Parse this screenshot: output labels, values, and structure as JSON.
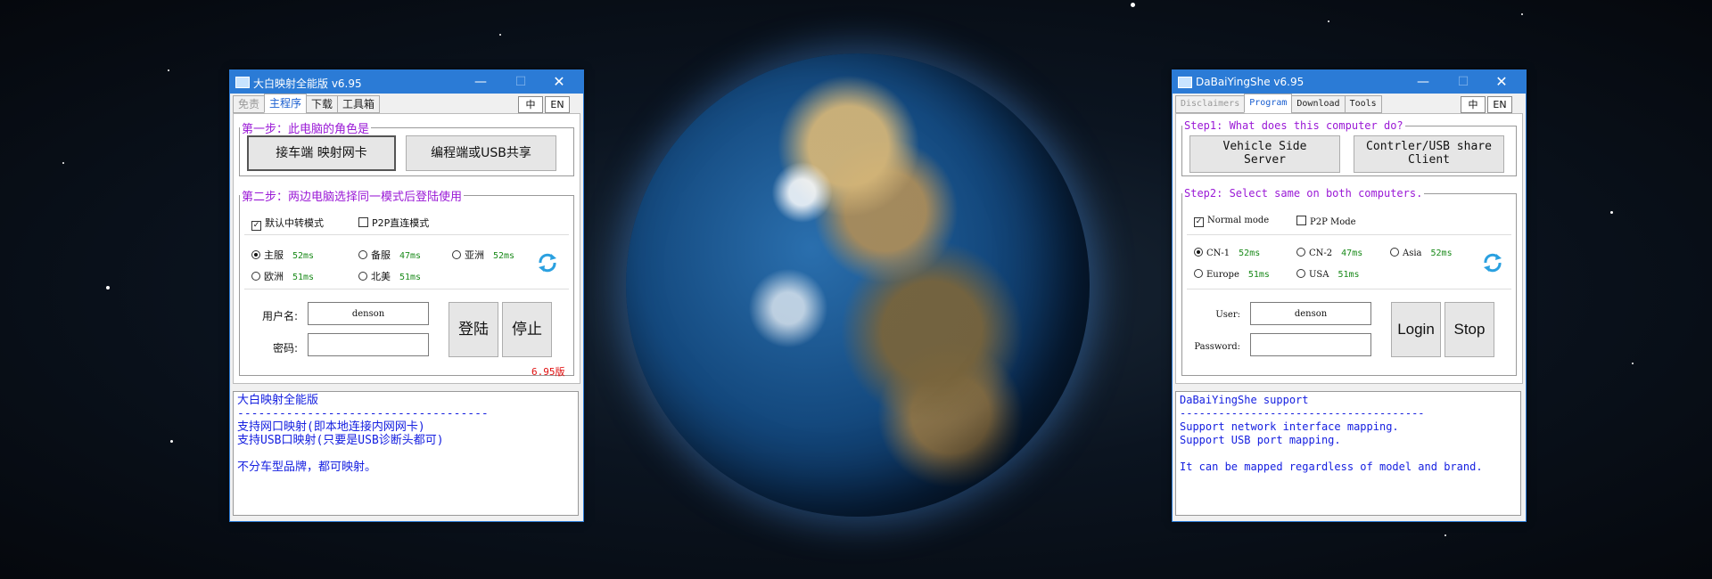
{
  "left_window": {
    "title": "大白映射全能版 v6.95",
    "window_controls": {
      "minimize": "—",
      "maximize": "☐",
      "close": "✕"
    },
    "tabs": [
      "免责",
      "主程序",
      "下载",
      "工具箱"
    ],
    "active_tab": "主程序",
    "lang_buttons": [
      "中",
      "EN"
    ],
    "step1_legend": "第一步：此电脑的角色是",
    "role_buttons": [
      "接车端 映射网卡",
      "编程端或USB共享"
    ],
    "step2_legend": "第二步：两边电脑选择同一模式后登陆使用",
    "modes": [
      {
        "label": "默认中转模式",
        "checked": true
      },
      {
        "label": "P2P直连模式",
        "checked": false
      }
    ],
    "servers": [
      {
        "name": "主服",
        "ping": "52ms",
        "selected": true
      },
      {
        "name": "备服",
        "ping": "47ms",
        "selected": false
      },
      {
        "name": "亚洲",
        "ping": "52ms",
        "selected": false
      },
      {
        "name": "欧洲",
        "ping": "51ms",
        "selected": false
      },
      {
        "name": "北美",
        "ping": "51ms",
        "selected": false
      }
    ],
    "user_label": "用户名:",
    "user_value": "denson",
    "password_label": "密码:",
    "password_value": "",
    "login_label": "登陆",
    "stop_label": "停止",
    "version_label": "6.95版",
    "log_lines": [
      "大白映射全能版",
      "------------------------------------",
      "支持网口映射(即本地连接内网网卡)",
      "支持USB口映射(只要是USB诊断头都可)",
      "",
      "不分车型品牌，都可映射。"
    ]
  },
  "right_window": {
    "title": "DaBaiYingShe v6.95",
    "window_controls": {
      "minimize": "—",
      "maximize": "☐",
      "close": "✕"
    },
    "tabs": [
      "Disclaimers",
      "Program",
      "Download",
      "Tools"
    ],
    "active_tab": "Program",
    "lang_buttons": [
      "中",
      "EN"
    ],
    "step1_legend": "Step1: What does this computer do?",
    "role_buttons": [
      "Vehicle Side\nServer",
      "Contrler/USB share\nClient"
    ],
    "step2_legend": "Step2: Select same on both computers.",
    "modes": [
      {
        "label": "Normal mode",
        "checked": true
      },
      {
        "label": "P2P Mode",
        "checked": false
      }
    ],
    "servers": [
      {
        "name": "CN-1",
        "ping": "52ms",
        "selected": true
      },
      {
        "name": "CN-2",
        "ping": "47ms",
        "selected": false
      },
      {
        "name": "Asia",
        "ping": "52ms",
        "selected": false
      },
      {
        "name": "Europe",
        "ping": "51ms",
        "selected": false
      },
      {
        "name": "USA",
        "ping": "51ms",
        "selected": false
      }
    ],
    "user_label": "User:",
    "user_value": "denson",
    "password_label": "Password:",
    "password_value": "",
    "login_label": "Login",
    "stop_label": "Stop",
    "log_lines": [
      "DaBaiYingShe support",
      "--------------------------------------",
      "Support network interface mapping.",
      "Support USB port mapping.",
      "",
      "It can be mapped regardless of model and brand."
    ]
  },
  "colors": {
    "titlebar": "#2b7bd6",
    "legend": "#9a19d6",
    "ping": "#1a8a1a",
    "log_text": "#1620e0",
    "version": "#e01010",
    "active_tab": "#1a5fd0"
  },
  "icons": [
    "app-icon",
    "refresh-icon",
    "minimize-icon",
    "maximize-icon",
    "close-icon"
  ]
}
